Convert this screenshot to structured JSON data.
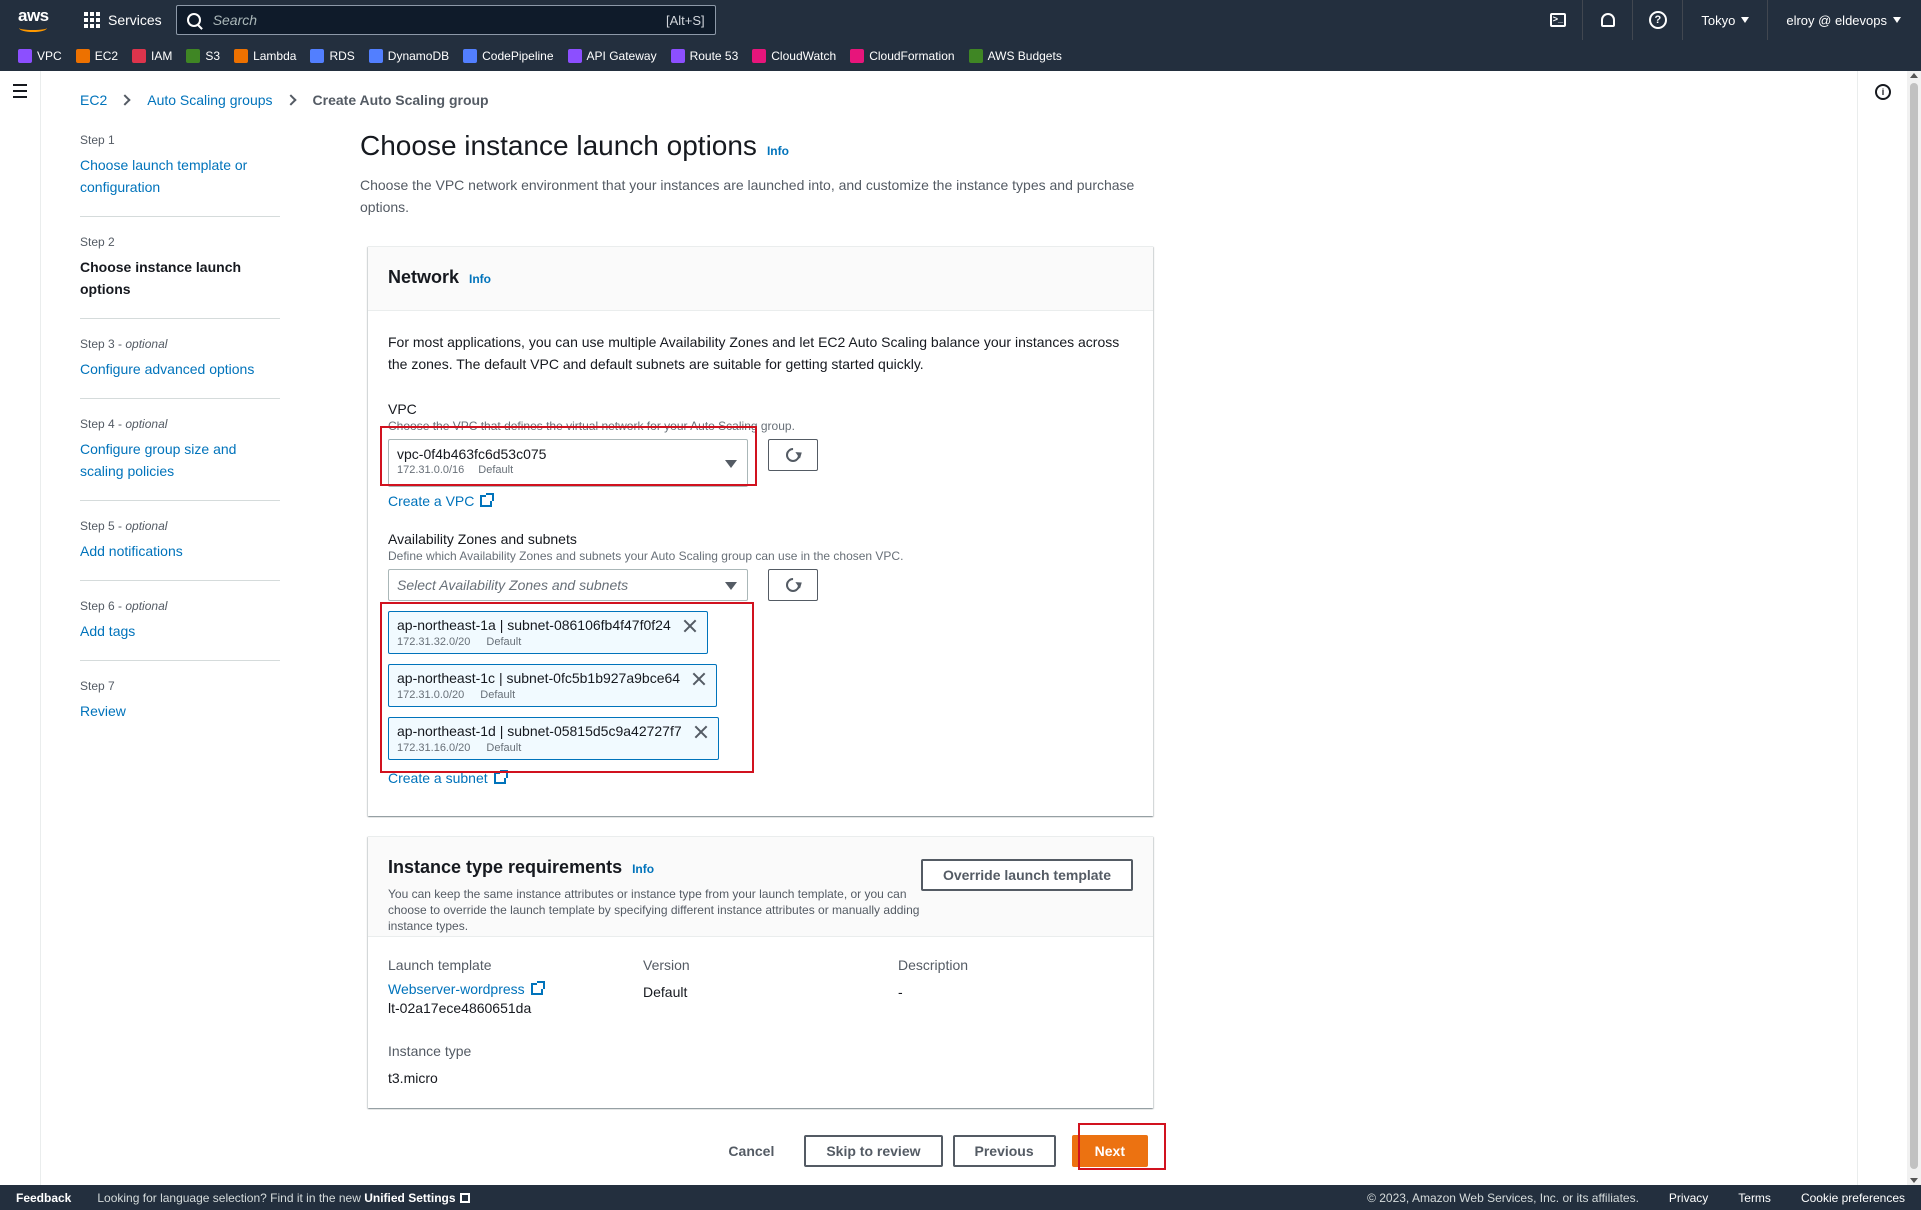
{
  "nav": {
    "logo": "aws",
    "services_label": "Services",
    "search_placeholder": "Search",
    "search_shortcut": "[Alt+S]",
    "region": "Tokyo",
    "user": "elroy @ eldevops"
  },
  "favorites": [
    {
      "label": "VPC",
      "color": "#8c4fff"
    },
    {
      "label": "EC2",
      "color": "#ed7100"
    },
    {
      "label": "IAM",
      "color": "#dd344c"
    },
    {
      "label": "S3",
      "color": "#3f8624"
    },
    {
      "label": "Lambda",
      "color": "#ed7100"
    },
    {
      "label": "RDS",
      "color": "#527fff"
    },
    {
      "label": "DynamoDB",
      "color": "#527fff"
    },
    {
      "label": "CodePipeline",
      "color": "#527fff"
    },
    {
      "label": "API Gateway",
      "color": "#8c4fff"
    },
    {
      "label": "Route 53",
      "color": "#8c4fff"
    },
    {
      "label": "CloudWatch",
      "color": "#e7157b"
    },
    {
      "label": "CloudFormation",
      "color": "#e7157b"
    },
    {
      "label": "AWS Budgets",
      "color": "#3f8624"
    }
  ],
  "breadcrumb": {
    "items": [
      "EC2",
      "Auto Scaling groups"
    ],
    "current": "Create Auto Scaling group"
  },
  "steps": [
    {
      "num": "Step 1",
      "optional": "",
      "label": "Choose launch template or configuration"
    },
    {
      "num": "Step 2",
      "optional": "",
      "label": "Choose instance launch options"
    },
    {
      "num": "Step 3",
      "optional": "optional",
      "label": "Configure advanced options"
    },
    {
      "num": "Step 4",
      "optional": "optional",
      "label": "Configure group size and scaling policies"
    },
    {
      "num": "Step 5",
      "optional": "optional",
      "label": "Add notifications"
    },
    {
      "num": "Step 6",
      "optional": "optional",
      "label": "Add tags"
    },
    {
      "num": "Step 7",
      "optional": "",
      "label": "Review"
    }
  ],
  "page": {
    "title": "Choose instance launch options",
    "info": "Info",
    "description": "Choose the VPC network environment that your instances are launched into, and customize the instance types and purchase options."
  },
  "network": {
    "title": "Network",
    "info": "Info",
    "paragraph": "For most applications, you can use multiple Availability Zones and let EC2 Auto Scaling balance your instances across the zones. The default VPC and default subnets are suitable for getting started quickly.",
    "vpc_label": "VPC",
    "vpc_desc": "Choose the VPC that defines the virtual network for your Auto Scaling group.",
    "vpc_value": "vpc-0f4b463fc6d53c075",
    "vpc_cidr": "172.31.0.0/16",
    "vpc_tag": "Default",
    "create_vpc": "Create a VPC",
    "az_label": "Availability Zones and subnets",
    "az_desc": "Define which Availability Zones and subnets your Auto Scaling group can use in the chosen VPC.",
    "az_placeholder": "Select Availability Zones and subnets",
    "subnets": [
      {
        "name": "ap-northeast-1a | subnet-086106fb4f47f0f24",
        "cidr": "172.31.32.0/20",
        "tag": "Default"
      },
      {
        "name": "ap-northeast-1c | subnet-0fc5b1b927a9bce64",
        "cidr": "172.31.0.0/20",
        "tag": "Default"
      },
      {
        "name": "ap-northeast-1d | subnet-05815d5c9a42727f7",
        "cidr": "172.31.16.0/20",
        "tag": "Default"
      }
    ],
    "create_subnet": "Create a subnet"
  },
  "instance": {
    "title": "Instance type requirements",
    "info": "Info",
    "description": "You can keep the same instance attributes or instance type from your launch template, or you can choose to override the launch template by specifying different instance attributes or manually adding instance types.",
    "override_btn": "Override launch template",
    "lt_label": "Launch template",
    "lt_name": "Webserver-wordpress",
    "lt_id": "lt-02a17ece4860651da",
    "version_label": "Version",
    "version_value": "Default",
    "desc_label": "Description",
    "desc_value": "-",
    "type_label": "Instance type",
    "type_value": "t3.micro"
  },
  "actions": {
    "cancel": "Cancel",
    "skip": "Skip to review",
    "previous": "Previous",
    "next": "Next"
  },
  "footer": {
    "feedback": "Feedback",
    "lang_text": "Looking for language selection? Find it in the new ",
    "lang_link": "Unified Settings",
    "copyright": "© 2023, Amazon Web Services, Inc. or its affiliates.",
    "privacy": "Privacy",
    "terms": "Terms",
    "cookies": "Cookie preferences"
  }
}
